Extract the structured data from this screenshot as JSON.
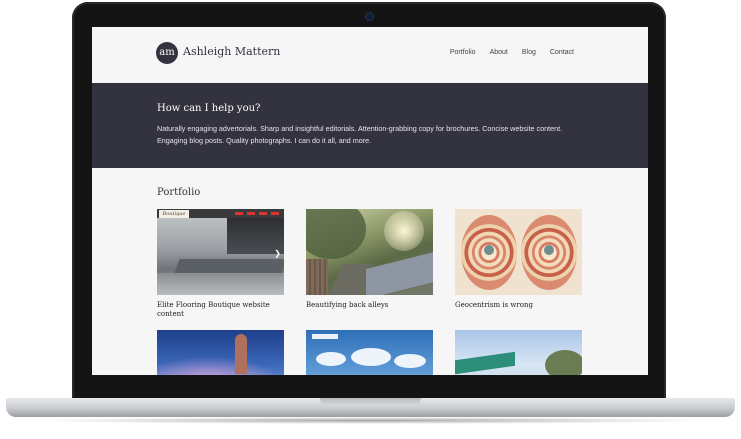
{
  "site": {
    "logo_initials": "am",
    "name": "Ashleigh Mattern"
  },
  "nav": {
    "items": [
      "Portfolio",
      "About",
      "Blog",
      "Contact"
    ]
  },
  "hero": {
    "title": "How can I help you?",
    "text": "Naturally engaging advertorials. Sharp and insightful editorials. Attention-grabbing copy for brochures. Concise website content. Engaging blog posts. Quality photographs. I can do it all, and more."
  },
  "portfolio": {
    "title": "Portfolio",
    "items": [
      {
        "caption": "Elite Flooring Boutique website content",
        "thumb_label": "Boutique"
      },
      {
        "caption": "Beautifying back alleys"
      },
      {
        "caption": "Geocentrism is wrong"
      },
      {
        "caption": ""
      },
      {
        "caption": ""
      },
      {
        "caption": ""
      }
    ]
  },
  "colors": {
    "dark_band": "#33323f",
    "page_bg": "#f6f6f6"
  }
}
